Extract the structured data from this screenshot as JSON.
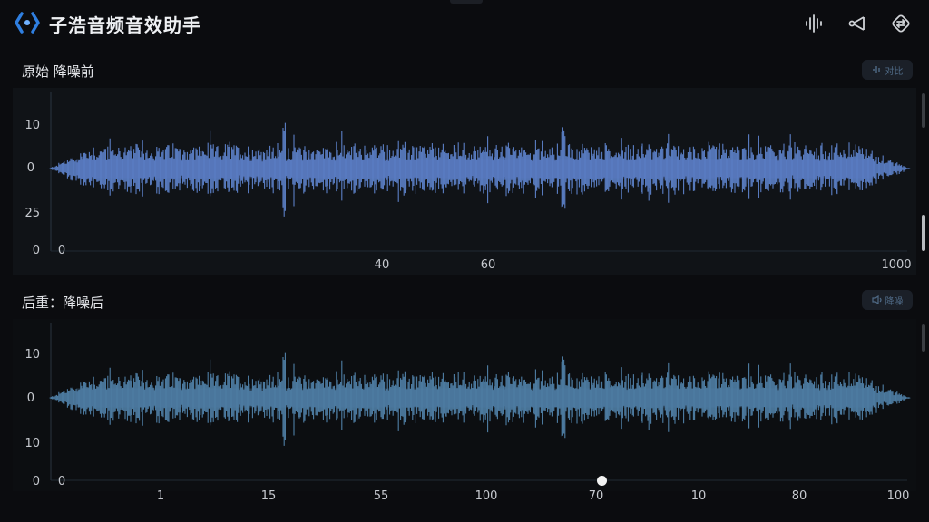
{
  "app": {
    "title": "子浩音频音效助手",
    "icons": [
      "app-logo-icon",
      "waveform-icon",
      "share-icon",
      "swap-icon"
    ]
  },
  "original_panel": {
    "title": "原始 降噪前",
    "button_label": "对比",
    "y_ticks": [
      "10",
      "0",
      "25",
      "0"
    ],
    "x_ticks": [
      "40",
      "60",
      "1000"
    ],
    "origin_label": "0",
    "wave_color": "#5b7fc6"
  },
  "processed_panel": {
    "title": "后重：降噪后",
    "button_label": "降噪",
    "y_ticks": [
      "10",
      "0",
      "10",
      "0"
    ],
    "x_ticks": [
      "1",
      "15",
      "55",
      "100",
      "70",
      "10",
      "80",
      "100"
    ],
    "origin_label": "0",
    "wave_color": "#4f7fa6"
  },
  "colors": {
    "background": "#0b0c0f",
    "panel_bg": "#101317",
    "accent": "#2f7fe0"
  }
}
